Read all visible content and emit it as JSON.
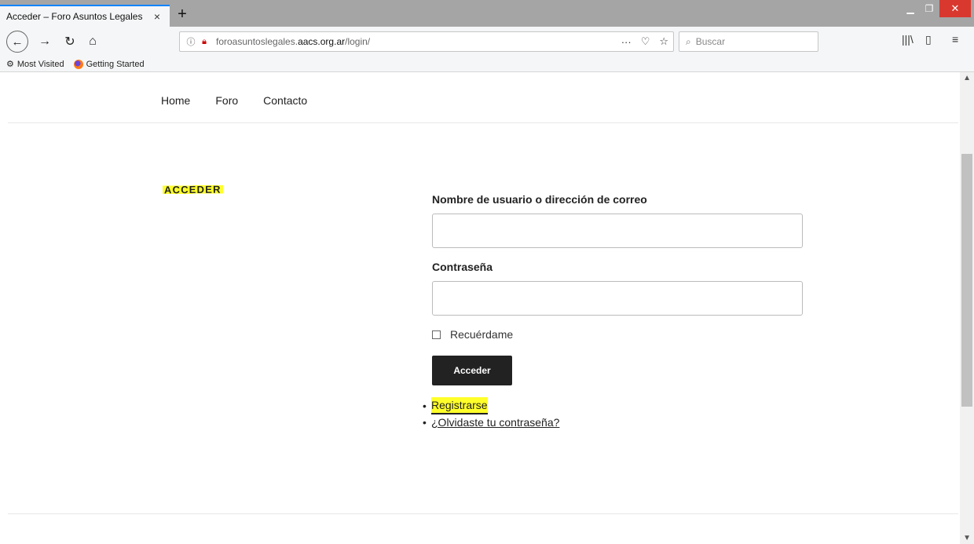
{
  "browser": {
    "tab_title": "Acceder – Foro Asuntos Legales",
    "tab_close": "×",
    "new_tab": "+",
    "url_prefix": "foroasuntoslegales.",
    "url_host": "aacs.org.ar",
    "url_path": "/login/",
    "search_placeholder": "Buscar",
    "bookmarks": [
      "Most Visited",
      "Getting Started"
    ],
    "colors": {
      "tab_accent": "#0a84ff",
      "close_button": "#d9382e",
      "chrome_bg": "#f5f6f7"
    }
  },
  "site": {
    "nav": [
      "Home",
      "Foro",
      "Contacto"
    ],
    "page_title": "ACCEDER"
  },
  "form": {
    "username_label": "Nombre de usuario o dirección de correo",
    "username_value": "",
    "password_label": "Contraseña",
    "password_value": "",
    "remember_label": "Recuérdame",
    "remember_checked": false,
    "submit_label": "Acceder"
  },
  "links": {
    "register": "Registrarse",
    "forgot": "¿Olvidaste tu contraseña?"
  },
  "highlight_color": "#ffff2a"
}
